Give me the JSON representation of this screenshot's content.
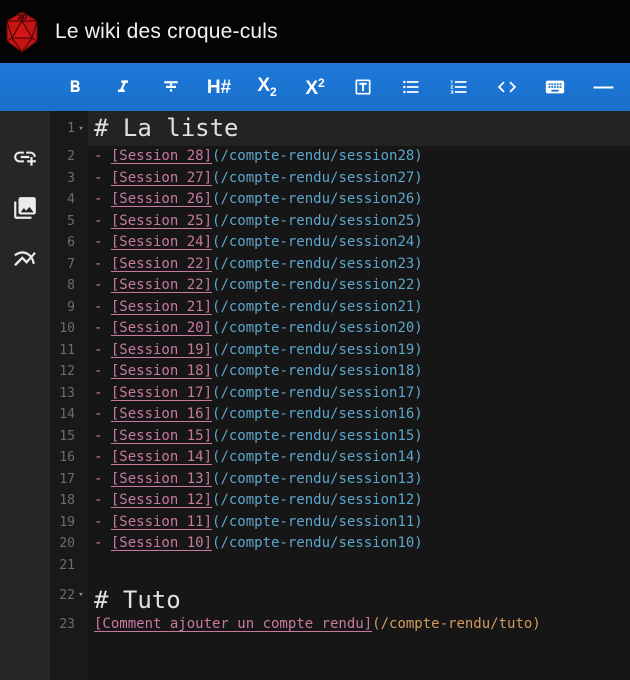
{
  "header": {
    "title": "Le wiki des croque-culs",
    "logo": "d20-die",
    "logo_color": "#c41414",
    "logo_number": "20"
  },
  "toolbar": {
    "background": "#1976d2",
    "buttons": [
      {
        "name": "bold"
      },
      {
        "name": "italic"
      },
      {
        "name": "strikethrough"
      },
      {
        "name": "heading"
      },
      {
        "name": "subscript"
      },
      {
        "name": "superscript"
      },
      {
        "name": "text-box"
      },
      {
        "name": "bullet-list"
      },
      {
        "name": "ordered-list"
      },
      {
        "name": "code"
      },
      {
        "name": "keyboard"
      },
      {
        "name": "horizontal-rule"
      }
    ],
    "glyphs": {
      "heading": "H#",
      "sub_base": "X",
      "sub_script": "2",
      "sup_base": "X",
      "sup_script": "2",
      "hr": "—"
    }
  },
  "sidebar": {
    "icons": [
      {
        "name": "add-link"
      },
      {
        "name": "photo-library"
      },
      {
        "name": "multiline-chart"
      }
    ]
  },
  "editor": {
    "fold_glyph": "▾",
    "colors": {
      "link": "#c9799f",
      "url": "#5ca6cc",
      "url_alt": "#d59a5e",
      "heading": "#e0e0e0",
      "active_line_bg": "#232323"
    },
    "lines": [
      {
        "num": 1,
        "kind": "heading",
        "active": true,
        "fold": true,
        "segments": [
          {
            "t": "# La liste",
            "s": "h"
          }
        ]
      },
      {
        "num": 2,
        "segments": [
          {
            "t": "- ",
            "s": "dash"
          },
          {
            "t": "[Session 28]",
            "s": "link"
          },
          {
            "t": "(/compte-rendu/session28)",
            "s": "url"
          }
        ]
      },
      {
        "num": 3,
        "segments": [
          {
            "t": "- ",
            "s": "dash"
          },
          {
            "t": "[Session 27]",
            "s": "link"
          },
          {
            "t": "(/compte-rendu/session27)",
            "s": "url"
          }
        ]
      },
      {
        "num": 4,
        "segments": [
          {
            "t": "- ",
            "s": "dash"
          },
          {
            "t": "[Session 26]",
            "s": "link"
          },
          {
            "t": "(/compte-rendu/session26)",
            "s": "url"
          }
        ]
      },
      {
        "num": 5,
        "segments": [
          {
            "t": "- ",
            "s": "dash"
          },
          {
            "t": "[Session 25]",
            "s": "link"
          },
          {
            "t": "(/compte-rendu/session25)",
            "s": "url"
          }
        ]
      },
      {
        "num": 6,
        "segments": [
          {
            "t": "- ",
            "s": "dash"
          },
          {
            "t": "[Session 24]",
            "s": "link"
          },
          {
            "t": "(/compte-rendu/session24)",
            "s": "url"
          }
        ]
      },
      {
        "num": 7,
        "segments": [
          {
            "t": "- ",
            "s": "dash"
          },
          {
            "t": "[Session 22]",
            "s": "link"
          },
          {
            "t": "(/compte-rendu/session23)",
            "s": "url"
          }
        ]
      },
      {
        "num": 8,
        "segments": [
          {
            "t": "- ",
            "s": "dash"
          },
          {
            "t": "[Session 22]",
            "s": "link"
          },
          {
            "t": "(/compte-rendu/session22)",
            "s": "url"
          }
        ]
      },
      {
        "num": 9,
        "segments": [
          {
            "t": "- ",
            "s": "dash"
          },
          {
            "t": "[Session 21]",
            "s": "link"
          },
          {
            "t": "(/compte-rendu/session21)",
            "s": "url"
          }
        ]
      },
      {
        "num": 10,
        "segments": [
          {
            "t": "- ",
            "s": "dash"
          },
          {
            "t": "[Session 20]",
            "s": "link"
          },
          {
            "t": "(/compte-rendu/session20)",
            "s": "url"
          }
        ]
      },
      {
        "num": 11,
        "segments": [
          {
            "t": "- ",
            "s": "dash"
          },
          {
            "t": "[Session 19]",
            "s": "link"
          },
          {
            "t": "(/compte-rendu/session19)",
            "s": "url"
          }
        ]
      },
      {
        "num": 12,
        "segments": [
          {
            "t": "- ",
            "s": "dash"
          },
          {
            "t": "[Session 18]",
            "s": "link"
          },
          {
            "t": "(/compte-rendu/session18)",
            "s": "url"
          }
        ]
      },
      {
        "num": 13,
        "segments": [
          {
            "t": "- ",
            "s": "dash"
          },
          {
            "t": "[Session 17]",
            "s": "link"
          },
          {
            "t": "(/compte-rendu/session17)",
            "s": "url"
          }
        ]
      },
      {
        "num": 14,
        "segments": [
          {
            "t": "- ",
            "s": "dash"
          },
          {
            "t": "[Session 16]",
            "s": "link"
          },
          {
            "t": "(/compte-rendu/session16)",
            "s": "url"
          }
        ]
      },
      {
        "num": 15,
        "segments": [
          {
            "t": "- ",
            "s": "dash"
          },
          {
            "t": "[Session 15]",
            "s": "link"
          },
          {
            "t": "(/compte-rendu/session15)",
            "s": "url"
          }
        ]
      },
      {
        "num": 16,
        "segments": [
          {
            "t": "- ",
            "s": "dash"
          },
          {
            "t": "[Session 14]",
            "s": "link"
          },
          {
            "t": "(/compte-rendu/session14)",
            "s": "url"
          }
        ]
      },
      {
        "num": 17,
        "segments": [
          {
            "t": "- ",
            "s": "dash"
          },
          {
            "t": "[Session 13]",
            "s": "link"
          },
          {
            "t": "(/compte-rendu/session13)",
            "s": "url"
          }
        ]
      },
      {
        "num": 18,
        "segments": [
          {
            "t": "- ",
            "s": "dash"
          },
          {
            "t": "[Session 12]",
            "s": "link"
          },
          {
            "t": "(/compte-rendu/session12)",
            "s": "url"
          }
        ]
      },
      {
        "num": 19,
        "segments": [
          {
            "t": "- ",
            "s": "dash"
          },
          {
            "t": "[Session 11]",
            "s": "link"
          },
          {
            "t": "(/compte-rendu/session11)",
            "s": "url"
          }
        ]
      },
      {
        "num": 20,
        "segments": [
          {
            "t": "- ",
            "s": "dash"
          },
          {
            "t": "[Session 10]",
            "s": "link"
          },
          {
            "t": "(/compte-rendu/session10)",
            "s": "url"
          }
        ]
      },
      {
        "num": 21,
        "segments": []
      },
      {
        "num": 22,
        "kind": "heading gap",
        "fold": true,
        "segments": [
          {
            "t": "# Tuto",
            "s": "h"
          }
        ]
      },
      {
        "num": 23,
        "segments": [
          {
            "t": "[Comment ajouter un compte rendu]",
            "s": "link"
          },
          {
            "t": "(/compte-rendu/tuto)",
            "s": "url2"
          }
        ]
      }
    ]
  }
}
